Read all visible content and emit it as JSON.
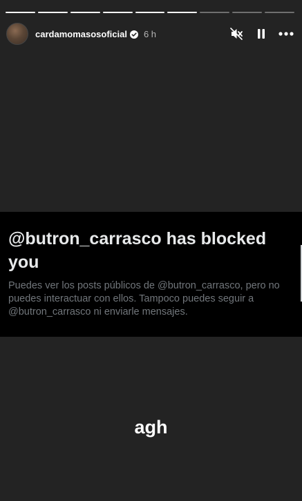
{
  "story": {
    "segments": [
      {
        "progress": 1
      },
      {
        "progress": 1
      },
      {
        "progress": 1
      },
      {
        "progress": 1
      },
      {
        "progress": 1
      },
      {
        "progress": 1
      },
      {
        "progress": 0
      },
      {
        "progress": 0
      },
      {
        "progress": 0
      }
    ],
    "username": "cardamomasosoficial",
    "time": "6 h",
    "verified_color": "#ffffff",
    "controls": {
      "mute_icon": "speaker-muted-icon",
      "pause_icon": "pause-icon",
      "more_icon": "more-options-icon"
    }
  },
  "screenshot": {
    "title": "@butron_carrasco has blocked you",
    "body": "Puedes ver los posts públicos de @butron_carrasco, pero no puedes interactuar con ellos. Tampoco puedes seguir a @butron_carrasco ni enviarle mensajes."
  },
  "caption": "agh"
}
